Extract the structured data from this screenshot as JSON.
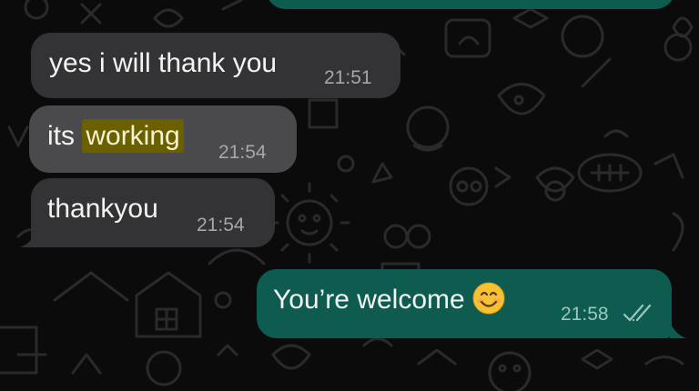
{
  "colors": {
    "background": "#0b0b0b",
    "incoming_bubble": "#333335",
    "incoming_bubble_highlighted": "#4a4a4c",
    "outgoing_bubble": "#0d5c4f",
    "search_highlight": "#6b6000"
  },
  "messages": [
    {
      "direction": "incoming",
      "text": "yes i will thank you",
      "time": "21:51"
    },
    {
      "direction": "incoming",
      "text_before": "its ",
      "text_highlight": "working",
      "time": "21:54",
      "search_match": true
    },
    {
      "direction": "incoming",
      "text": "thankyou",
      "time": "21:54"
    },
    {
      "direction": "outgoing",
      "text": "You’re welcome",
      "emoji": "smiling-face-emoji",
      "time": "21:58",
      "status_icon": "double-check-icon"
    }
  ]
}
